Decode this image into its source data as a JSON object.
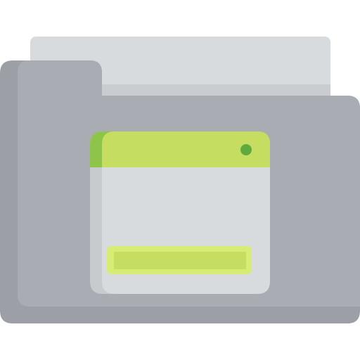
{
  "icon": {
    "name": "folder-application-icon",
    "colors": {
      "folder_back_sheet": "#d8dbde",
      "folder_back_sheet_shadow": "#c9ccd0",
      "folder_body": "#a9adb3",
      "folder_body_shadow": "#9ca0a6",
      "window_side": "#c8cbce",
      "window_body": "#d8dbde",
      "window_titlebar": "#c5dd60",
      "window_titlebar_side": "#8fc44b",
      "window_dot": "#5faa3d",
      "window_bar_outer": "#d7ec75",
      "window_bar_inner": "#c5dd60"
    }
  }
}
